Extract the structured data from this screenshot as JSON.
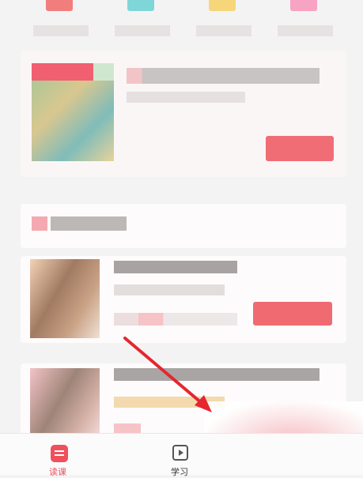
{
  "colors": {
    "accent": "#f0505c",
    "pink_light": "#f9c8cc",
    "gray_blur": "#cfcbcb",
    "arrow": "#e5262f"
  },
  "top_categories": [
    {
      "icon": "category-icon-red",
      "color": "#f27d7d"
    },
    {
      "icon": "category-icon-cyan",
      "color": "#7fd6d8"
    },
    {
      "icon": "category-icon-yellow",
      "color": "#f6d67a"
    },
    {
      "icon": "category-icon-pink",
      "color": "#f7a3c2"
    }
  ],
  "tabs": [
    {
      "label": "读课",
      "icon": "course-tab-icon",
      "active": true
    },
    {
      "label": "学习",
      "icon": "play-tab-icon",
      "active": false
    }
  ]
}
